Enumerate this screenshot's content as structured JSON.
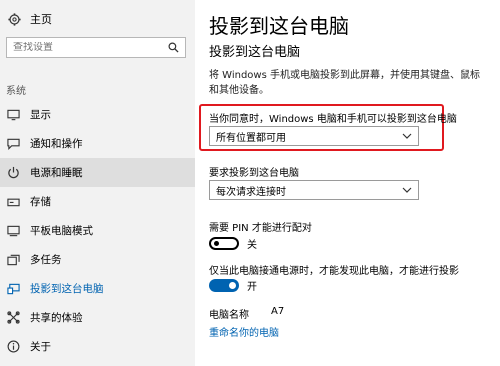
{
  "sidebar": {
    "home_label": "主页",
    "search_placeholder": "查找设置",
    "section_label": "系统",
    "items": [
      {
        "label": "显示",
        "icon": "display-icon"
      },
      {
        "label": "通知和操作",
        "icon": "notification-icon"
      },
      {
        "label": "电源和睡眠",
        "icon": "power-icon",
        "selected": true
      },
      {
        "label": "存储",
        "icon": "storage-icon"
      },
      {
        "label": "平板电脑模式",
        "icon": "tablet-mode-icon"
      },
      {
        "label": "多任务",
        "icon": "multitasking-icon"
      },
      {
        "label": "投影到这台电脑",
        "icon": "project-icon",
        "active": true
      },
      {
        "label": "共享的体验",
        "icon": "shared-experience-icon"
      },
      {
        "label": "关于",
        "icon": "info-icon"
      }
    ]
  },
  "main": {
    "page_title": "投影到这台电脑",
    "section_title": "投影到这台电脑",
    "description": "将 Windows 手机或电脑投影到此屏幕，并使用其键盘、鼠标和其他设备。",
    "availability": {
      "label": "当你同意时，Windows 电脑和手机可以投影到这台电脑",
      "value": "所有位置都可用"
    },
    "request": {
      "label": "要求投影到这台电脑",
      "value": "每次请求连接时"
    },
    "pin": {
      "label": "需要 PIN 才能进行配对",
      "state_text": "关",
      "on": false
    },
    "plugged": {
      "label": "仅当此电脑接通电源时，才能发现此电脑，才能进行投影",
      "state_text": "开",
      "on": true
    },
    "pc_name": {
      "label": "电脑名称",
      "value": "A7"
    },
    "rename_link": "重命名你的电脑"
  },
  "colors": {
    "accent": "#0063b1",
    "highlight_border": "#e0191f",
    "sidebar_bg": "#f2f2f2"
  }
}
